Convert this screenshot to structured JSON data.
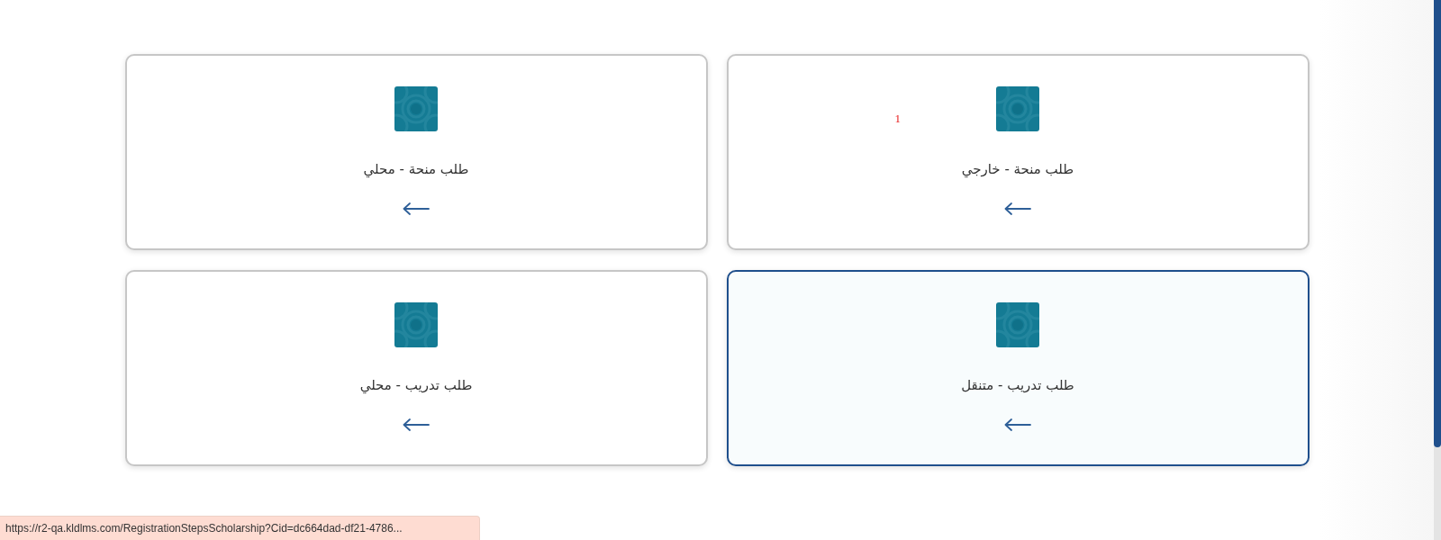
{
  "cards": [
    {
      "title": "طلب منحة - خارجي",
      "selected": false,
      "badge": "1"
    },
    {
      "title": "طلب منحة - محلي",
      "selected": false
    },
    {
      "title": "طلب تدريب - متنقل",
      "selected": true
    },
    {
      "title": "طلب تدريب - محلي",
      "selected": false
    }
  ],
  "status_bar": {
    "url": "https://r2-qa.kldlms.com/RegistrationStepsScholarship?Cid=dc664dad-df21-4786..."
  }
}
